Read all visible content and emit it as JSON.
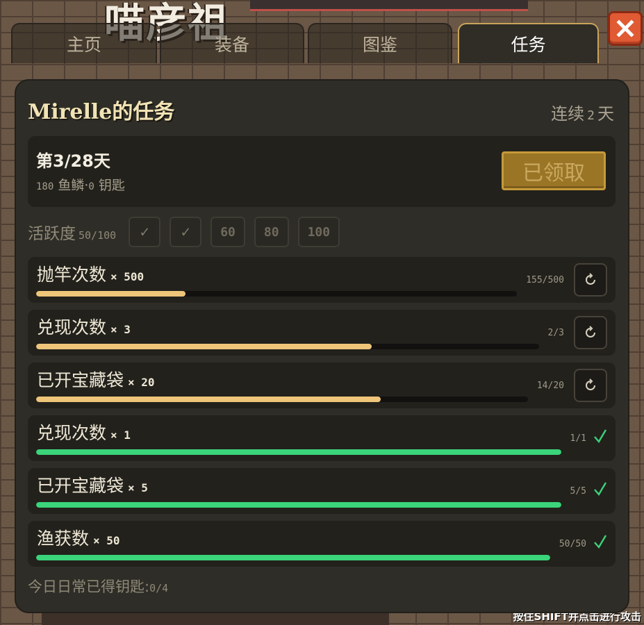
{
  "background": {
    "game_title": "喵彦祖",
    "hint_prefix": "按住",
    "hint_key": "SHIFT",
    "hint_suffix": "并点击进行攻击"
  },
  "tabs": [
    {
      "label": "主页",
      "active": false
    },
    {
      "label": "装备",
      "active": false
    },
    {
      "label": "图鉴",
      "active": false
    },
    {
      "label": "任务",
      "active": true
    }
  ],
  "close_icon": "close-x-icon",
  "panel": {
    "title": "Mirelle的任务",
    "streak_prefix": "连续",
    "streak_days": "2",
    "streak_suffix": "天"
  },
  "day_card": {
    "title": "第3/28天",
    "reward_fish": "180",
    "reward_fish_label": "鱼鳞·",
    "reward_keys": "0",
    "reward_keys_label": "钥匙",
    "claim_label": "已领取"
  },
  "activity": {
    "label": "活跃度",
    "value": "50/100",
    "milestones": [
      {
        "label": "✓",
        "done": true
      },
      {
        "label": "✓",
        "done": true
      },
      {
        "label": "60",
        "done": false
      },
      {
        "label": "80",
        "done": false
      },
      {
        "label": "100",
        "done": false
      }
    ]
  },
  "tasks": [
    {
      "name": "抛竿次数",
      "mult": "× 500",
      "count": "155/500",
      "progress": 0.31,
      "complete": false
    },
    {
      "name": "兑现次数",
      "mult": "× 3",
      "count": "2/3",
      "progress": 0.667,
      "complete": false
    },
    {
      "name": "已开宝藏袋",
      "mult": "× 20",
      "count": "14/20",
      "progress": 0.7,
      "complete": false
    },
    {
      "name": "兑现次数",
      "mult": "× 1",
      "count": "1/1",
      "progress": 1.0,
      "complete": true
    },
    {
      "name": "已开宝藏袋",
      "mult": "× 5",
      "count": "5/5",
      "progress": 1.0,
      "complete": true
    },
    {
      "name": "渔获数",
      "mult": "× 50",
      "count": "50/50",
      "progress": 1.0,
      "complete": true
    }
  ],
  "footer": {
    "label": "今日日常已得钥匙:",
    "value": "0/4"
  },
  "colors": {
    "accent_gold": "#efc57a",
    "complete_green": "#3ad47a",
    "close_red": "#e05a33"
  }
}
